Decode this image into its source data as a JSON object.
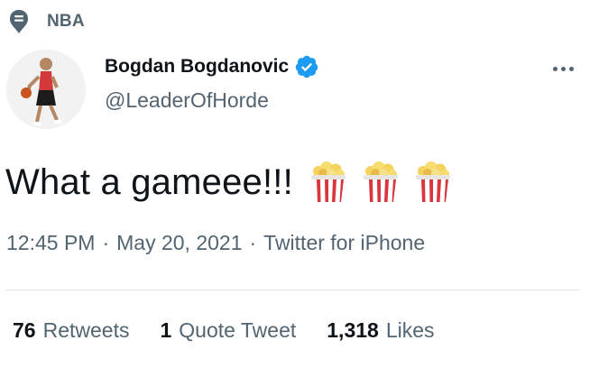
{
  "topic": {
    "icon": "topic-pin-icon",
    "label": "NBA"
  },
  "author": {
    "avatar": "avatar-photo",
    "name": "Bogdan Bogdanovic",
    "verified": true,
    "verified_icon": "verified-badge-icon",
    "handle": "@LeaderOfHorde"
  },
  "more_menu": {
    "icon": "more-dots-icon"
  },
  "tweet": {
    "text": "What a gameee!!!",
    "emoji": [
      "popcorn-icon",
      "popcorn-icon",
      "popcorn-icon"
    ]
  },
  "meta": {
    "time": "12:45 PM",
    "separator": "·",
    "date": "May 20, 2021",
    "source": "Twitter for iPhone"
  },
  "stats": {
    "retweets": {
      "count": "76",
      "label": "Retweets"
    },
    "quotes": {
      "count": "1",
      "label": "Quote Tweet"
    },
    "likes": {
      "count": "1,318",
      "label": "Likes"
    }
  },
  "colors": {
    "text": "#0f1419",
    "secondary": "#536471",
    "verified": "#1d9bf0",
    "divider": "#e1e5e8"
  }
}
